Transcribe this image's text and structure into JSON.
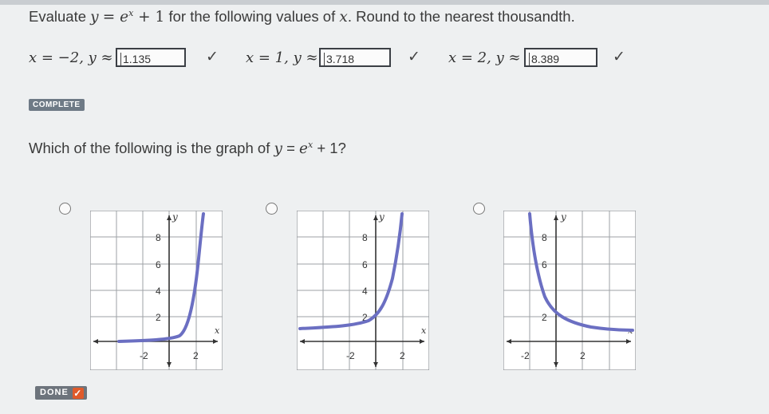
{
  "question1": {
    "prefix": "Evaluate ",
    "func_lhs": "y",
    "func_eq": "= ",
    "func_base": "e",
    "func_exp": "x",
    "func_tail": " + 1",
    "suffix": " for the following values of ",
    "var": "x",
    "suffix2": ". Round to the nearest thousandth."
  },
  "rows": [
    {
      "label": "x = −2, y ≈",
      "value": "1.135",
      "check": "✓"
    },
    {
      "label": "x = 1, y ≈",
      "value": "3.718",
      "check": "✓"
    },
    {
      "label": "x = 2, y ≈",
      "value": "8.389",
      "check": "✓"
    }
  ],
  "complete_badge": "COMPLETE",
  "question2": {
    "prefix": "Which of the following is the graph of ",
    "func_lhs": "y",
    "func_eq": " = ",
    "func_base": "e",
    "func_exp": "x",
    "func_tail": " + 1?"
  },
  "graphs": {
    "y_axis_label": "y",
    "x_axis_label": "x",
    "y_ticks": [
      "8",
      "6",
      "4",
      "2"
    ],
    "x_ticks": [
      "-2",
      "2"
    ],
    "curve_color": "#6b6fc2"
  },
  "done": {
    "label": "DONE",
    "check": "✓"
  }
}
